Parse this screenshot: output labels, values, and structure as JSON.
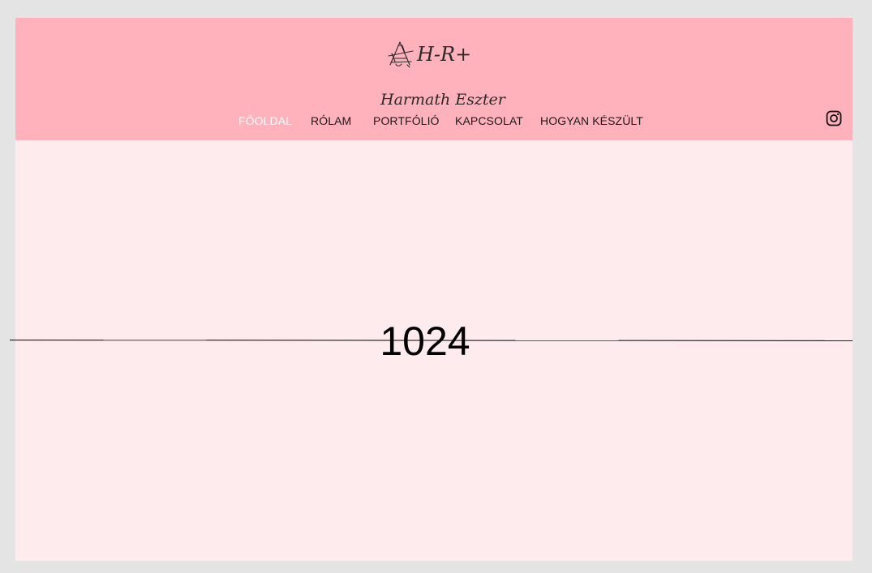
{
  "brand": {
    "logo_text": "H-R+",
    "name": "Harmath Eszter"
  },
  "nav": {
    "items": [
      {
        "label": "FŐOLDAL",
        "active": true
      },
      {
        "label": "RÓLAM",
        "active": false
      },
      {
        "label": "PORTFÓLIÓ",
        "active": false
      },
      {
        "label": "KAPCSOLAT",
        "active": false
      },
      {
        "label": "HOGYAN KÉSZÜLT",
        "active": false
      }
    ],
    "social_icon": "instagram-icon"
  },
  "main": {
    "width_readout": "1024"
  },
  "colors": {
    "header_bg": "#ffb1bc",
    "page_bg": "#feebee",
    "outer_bg": "#e4e4e4",
    "nav_active": "#ffffff",
    "nav_text": "#1a1a1a"
  }
}
